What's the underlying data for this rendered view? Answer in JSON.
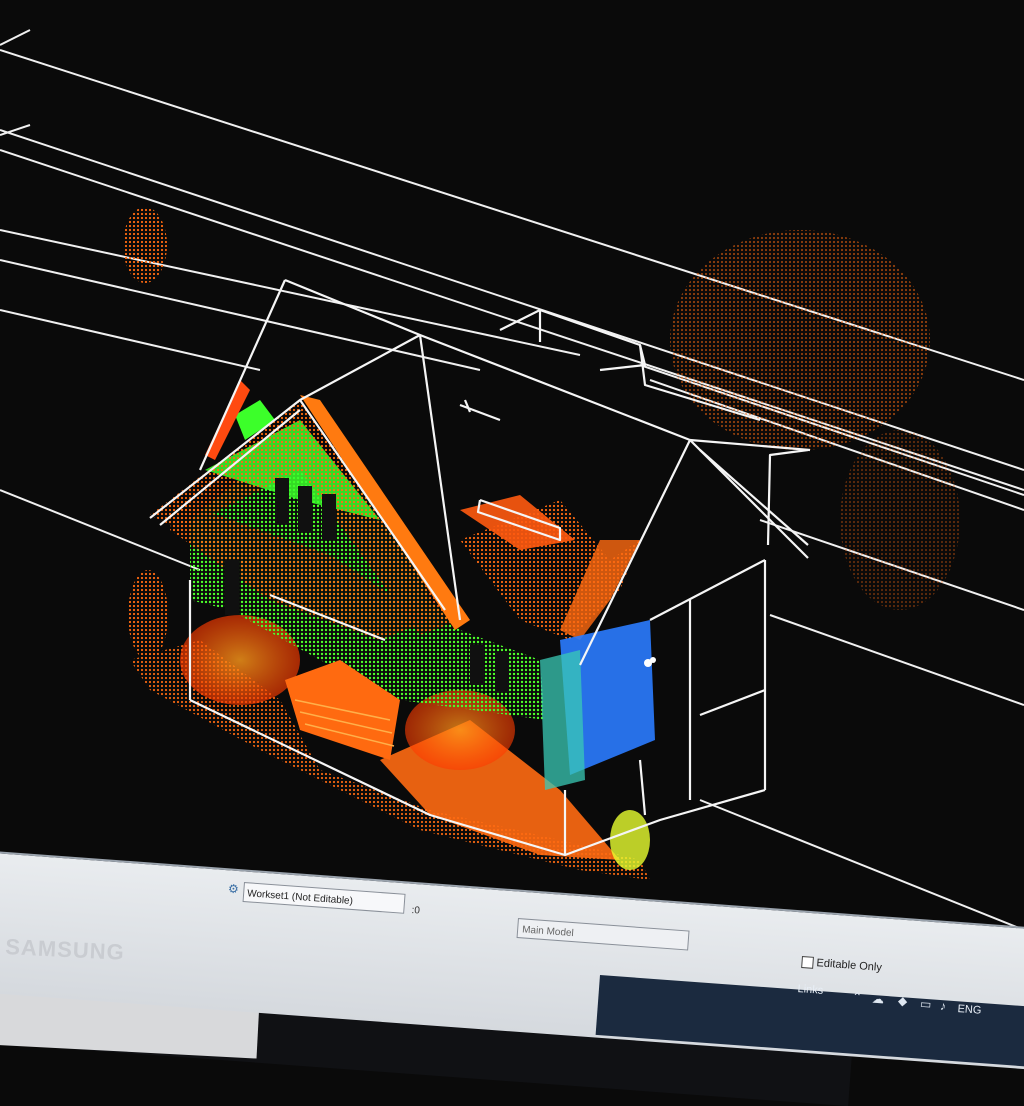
{
  "status_bar": {
    "workset": "Workset1 (Not Editable)",
    "counter": ":0",
    "model": "Main Model",
    "editable_only": "Editable Only"
  },
  "taskbar": {
    "links": "Links",
    "language": "ENG"
  },
  "monitor": {
    "brand": "SAMSUNG"
  },
  "colors": {
    "background": "#0a0a0a",
    "wireframe": "#f2f2f2",
    "points_green": "#3cff2a",
    "points_orange": "#ff7a10",
    "points_red": "#ff3a00",
    "points_blue": "#2a7bff"
  }
}
